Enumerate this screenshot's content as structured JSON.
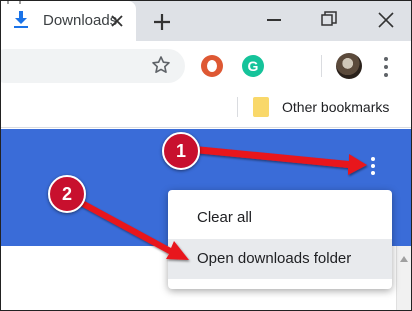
{
  "tab": {
    "title": "Downloads"
  },
  "bookmarks": {
    "folder_label": "Other bookmarks"
  },
  "extensions": {
    "grammarly_letter": "G"
  },
  "menu": {
    "items": [
      {
        "label": "Clear all"
      },
      {
        "label": "Open downloads folder"
      }
    ]
  },
  "callouts": {
    "step1": "1",
    "step2": "2"
  },
  "colors": {
    "header_blue": "#3a6cd8",
    "callout_red": "#c8102e",
    "tab_icon_blue": "#1a73e8"
  }
}
